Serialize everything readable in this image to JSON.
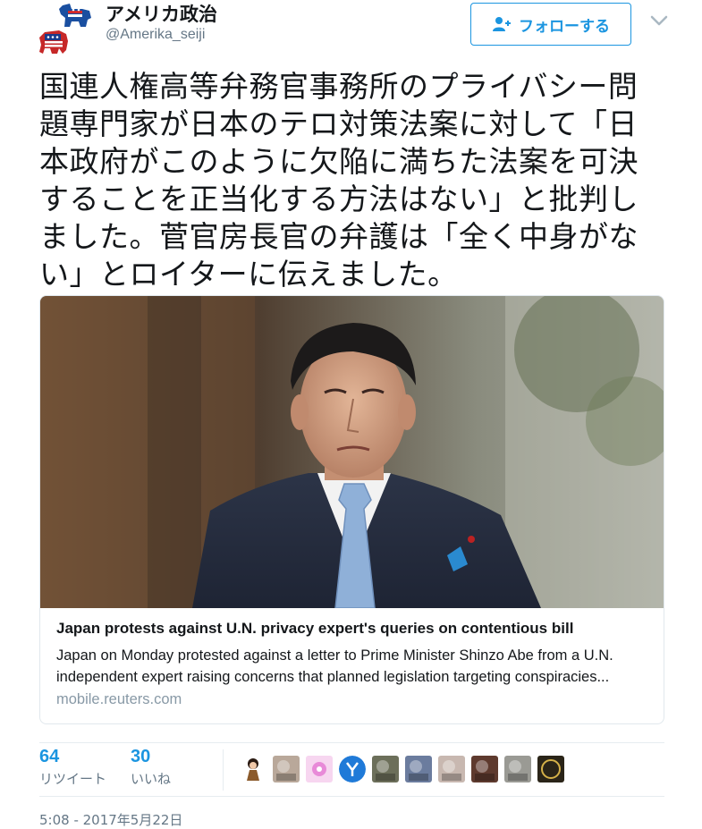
{
  "user": {
    "display_name": "アメリカ政治",
    "screen_name": "@Amerika_seiji",
    "avatar_icon": "party-mascots-icon"
  },
  "follow_button": {
    "label": "フォローする",
    "icon": "follow-person-plus-icon",
    "color": "#1b95e0"
  },
  "more_menu": {
    "icon": "chevron-down-icon"
  },
  "tweet": {
    "text": "国連人権高等弁務官事務所のプライバシー問\n題専門家が日本のテロ対策法案に対して「日\n本政府がこのように欠陥に満ちた法案を可決\nすることを正当化する方法はない」と批判し\nました。菅官房長官の弁護は「全く中身がな\nい」とロイターに伝えました。"
  },
  "card": {
    "title": "Japan protests against U.N. privacy expert's queries on contentious bill",
    "description": "Japan on Monday protested against a letter to Prime Minister Shinzo Abe from a U.N. independent expert raising concerns that planned legislation targeting conspiracies...",
    "domain": "mobile.reuters.com"
  },
  "stats": {
    "retweets": {
      "count": "64",
      "label": "リツイート"
    },
    "likes": {
      "count": "30",
      "label": "いいね"
    }
  },
  "likers": [
    {
      "icon": "avatar-doll-icon",
      "color": "#8b5a2b"
    },
    {
      "icon": "avatar-photo-icon",
      "color": "#b9a89a"
    },
    {
      "icon": "avatar-flower-icon",
      "color": "#e88ad8"
    },
    {
      "icon": "avatar-letter-y-icon",
      "color": "#1f7ad8"
    },
    {
      "icon": "avatar-photo-icon",
      "color": "#6c6f5a"
    },
    {
      "icon": "avatar-photo-icon",
      "color": "#6b7c9e"
    },
    {
      "icon": "avatar-photo-icon",
      "color": "#c8b8b0"
    },
    {
      "icon": "avatar-photo-icon",
      "color": "#5e3a2e"
    },
    {
      "icon": "avatar-photo-icon",
      "color": "#9a9a94"
    },
    {
      "icon": "avatar-badge-icon",
      "color": "#2a2418"
    }
  ],
  "timestamp": "5:08 - 2017年5月22日"
}
